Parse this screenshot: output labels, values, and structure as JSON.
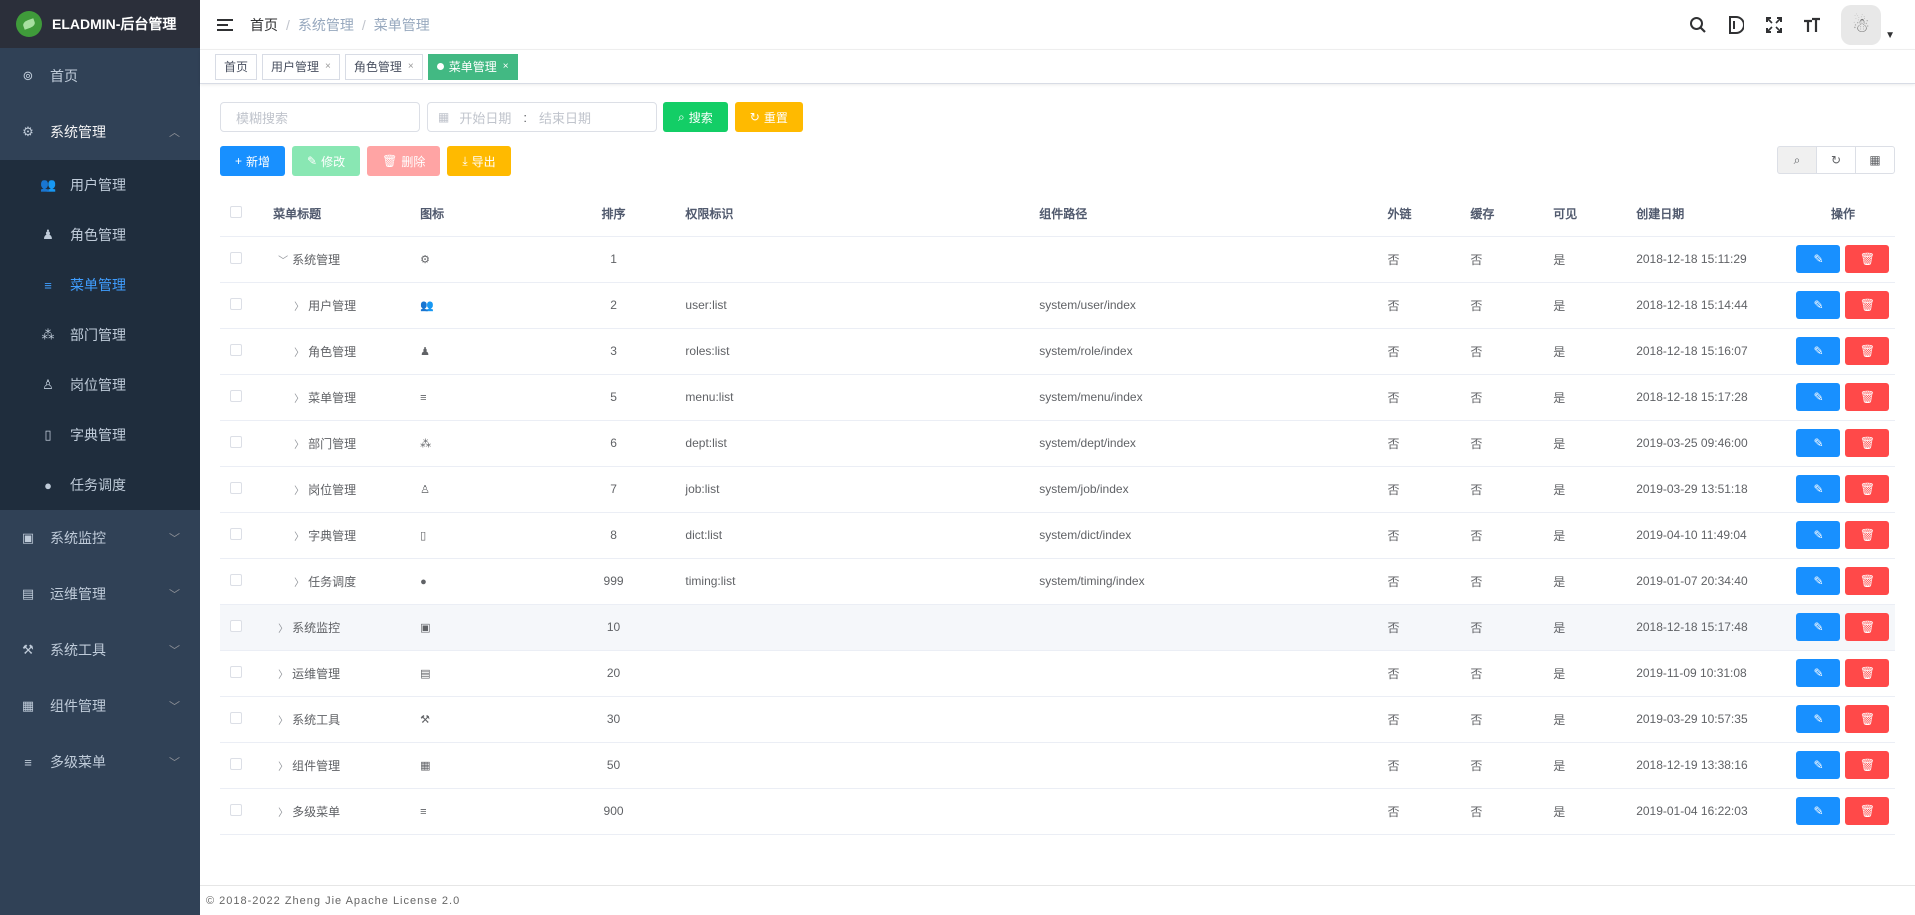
{
  "app": {
    "title": "ELADMIN-后台管理"
  },
  "sidebar": {
    "items": [
      {
        "label": "首页",
        "icon": "dashboard-icon",
        "glyph": "⊚"
      },
      {
        "label": "系统管理",
        "icon": "gear-icon",
        "glyph": "⚙",
        "open": true,
        "children": [
          {
            "label": "用户管理",
            "icon": "user-icon",
            "glyph": "👥"
          },
          {
            "label": "角色管理",
            "icon": "role-icon",
            "glyph": "♟"
          },
          {
            "label": "菜单管理",
            "icon": "menu-icon",
            "glyph": "≡",
            "active": true
          },
          {
            "label": "部门管理",
            "icon": "dept-icon",
            "glyph": "⁂"
          },
          {
            "label": "岗位管理",
            "icon": "job-icon",
            "glyph": "♙"
          },
          {
            "label": "字典管理",
            "icon": "dict-icon",
            "glyph": "▯"
          },
          {
            "label": "任务调度",
            "icon": "timing-icon",
            "glyph": "●"
          }
        ]
      },
      {
        "label": "系统监控",
        "icon": "monitor-icon",
        "glyph": "▣"
      },
      {
        "label": "运维管理",
        "icon": "mnt-icon",
        "glyph": "▤"
      },
      {
        "label": "系统工具",
        "icon": "tools-icon",
        "glyph": "⚒"
      },
      {
        "label": "组件管理",
        "icon": "component-icon",
        "glyph": "▦"
      },
      {
        "label": "多级菜单",
        "icon": "nested-menu-icon",
        "glyph": "≡"
      }
    ]
  },
  "breadcrumb": [
    "首页",
    "系统管理",
    "菜单管理"
  ],
  "tags": [
    {
      "label": "首页",
      "closable": false
    },
    {
      "label": "用户管理",
      "closable": true
    },
    {
      "label": "角色管理",
      "closable": true
    },
    {
      "label": "菜单管理",
      "closable": true,
      "active": true
    }
  ],
  "search": {
    "placeholder": "模糊搜索",
    "start_placeholder": "开始日期",
    "range_separator": ":",
    "end_placeholder": "结束日期",
    "search_label": "搜索",
    "reset_label": "重置"
  },
  "toolbar": {
    "add_label": "新增",
    "edit_label": "修改",
    "delete_label": "删除",
    "export_label": "导出"
  },
  "table": {
    "columns": [
      "菜单标题",
      "图标",
      "排序",
      "权限标识",
      "组件路径",
      "外链",
      "缓存",
      "可见",
      "创建日期",
      "操作"
    ],
    "rows": [
      {
        "title": "系统管理",
        "level": 0,
        "expanded": true,
        "icon": "gear-icon",
        "glyph": "⚙",
        "sort": "1",
        "perm": "",
        "path": "",
        "iframe": "否",
        "cache": "否",
        "visible": "是",
        "date": "2018-12-18 15:11:29"
      },
      {
        "title": "用户管理",
        "level": 1,
        "icon": "user-icon",
        "glyph": "👥",
        "sort": "2",
        "perm": "user:list",
        "path": "system/user/index",
        "iframe": "否",
        "cache": "否",
        "visible": "是",
        "date": "2018-12-18 15:14:44"
      },
      {
        "title": "角色管理",
        "level": 1,
        "icon": "role-icon",
        "glyph": "♟",
        "sort": "3",
        "perm": "roles:list",
        "path": "system/role/index",
        "iframe": "否",
        "cache": "否",
        "visible": "是",
        "date": "2018-12-18 15:16:07"
      },
      {
        "title": "菜单管理",
        "level": 1,
        "icon": "menu-icon",
        "glyph": "≡",
        "sort": "5",
        "perm": "menu:list",
        "path": "system/menu/index",
        "iframe": "否",
        "cache": "否",
        "visible": "是",
        "date": "2018-12-18 15:17:28"
      },
      {
        "title": "部门管理",
        "level": 1,
        "icon": "dept-icon",
        "glyph": "⁂",
        "sort": "6",
        "perm": "dept:list",
        "path": "system/dept/index",
        "iframe": "否",
        "cache": "否",
        "visible": "是",
        "date": "2019-03-25 09:46:00"
      },
      {
        "title": "岗位管理",
        "level": 1,
        "icon": "job-icon",
        "glyph": "♙",
        "sort": "7",
        "perm": "job:list",
        "path": "system/job/index",
        "iframe": "否",
        "cache": "否",
        "visible": "是",
        "date": "2019-03-29 13:51:18"
      },
      {
        "title": "字典管理",
        "level": 1,
        "icon": "dict-icon",
        "glyph": "▯",
        "sort": "8",
        "perm": "dict:list",
        "path": "system/dict/index",
        "iframe": "否",
        "cache": "否",
        "visible": "是",
        "date": "2019-04-10 11:49:04"
      },
      {
        "title": "任务调度",
        "level": 1,
        "icon": "timing-icon",
        "glyph": "●",
        "sort": "999",
        "perm": "timing:list",
        "path": "system/timing/index",
        "iframe": "否",
        "cache": "否",
        "visible": "是",
        "date": "2019-01-07 20:34:40"
      },
      {
        "title": "系统监控",
        "level": 0,
        "hover": true,
        "icon": "monitor-icon",
        "glyph": "▣",
        "sort": "10",
        "perm": "",
        "path": "",
        "iframe": "否",
        "cache": "否",
        "visible": "是",
        "date": "2018-12-18 15:17:48"
      },
      {
        "title": "运维管理",
        "level": 0,
        "icon": "mnt-icon",
        "glyph": "▤",
        "sort": "20",
        "perm": "",
        "path": "",
        "iframe": "否",
        "cache": "否",
        "visible": "是",
        "date": "2019-11-09 10:31:08"
      },
      {
        "title": "系统工具",
        "level": 0,
        "icon": "tools-icon",
        "glyph": "⚒",
        "sort": "30",
        "perm": "",
        "path": "",
        "iframe": "否",
        "cache": "否",
        "visible": "是",
        "date": "2019-03-29 10:57:35"
      },
      {
        "title": "组件管理",
        "level": 0,
        "icon": "component-icon",
        "glyph": "▦",
        "sort": "50",
        "perm": "",
        "path": "",
        "iframe": "否",
        "cache": "否",
        "visible": "是",
        "date": "2018-12-19 13:38:16"
      },
      {
        "title": "多级菜单",
        "level": 0,
        "icon": "nested-menu-icon",
        "glyph": "≡",
        "sort": "900",
        "perm": "",
        "path": "",
        "iframe": "否",
        "cache": "否",
        "visible": "是",
        "date": "2019-01-04 16:22:03"
      }
    ]
  },
  "footer": {
    "text": "© 2018-2022 Zheng Jie Apache License 2.0"
  },
  "colors": {
    "sidebar_bg": "#304156",
    "submenu_bg": "#1f2d3d",
    "active": "#409eff",
    "tag_active": "#42b983",
    "primary": "#1890ff",
    "success": "#13ce66",
    "warning": "#ffba00",
    "danger": "#ff4949"
  }
}
